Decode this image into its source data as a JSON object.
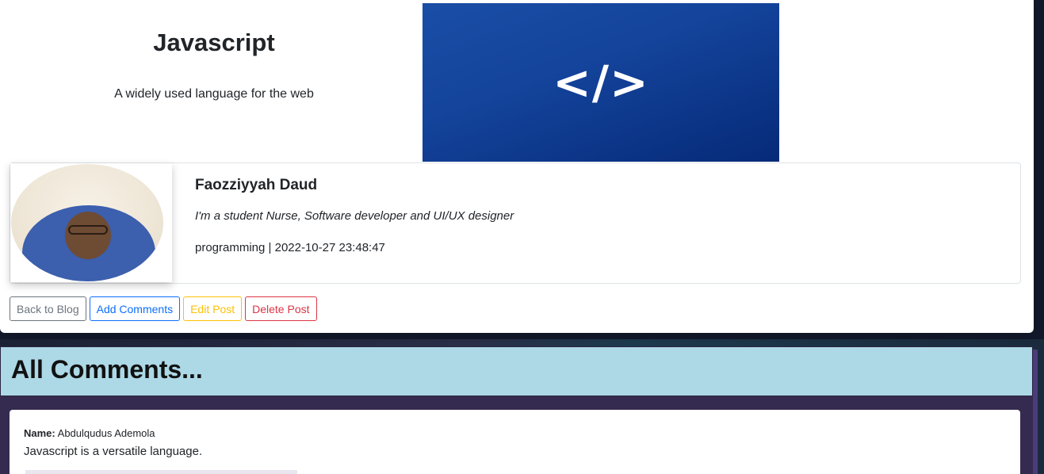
{
  "post": {
    "title": "Javascript",
    "subtitle": "A widely used language for the web",
    "image_symbol": "</>"
  },
  "author": {
    "name": "Faozziyyah Daud",
    "bio": "I'm a student Nurse, Software developer and UI/UX designer",
    "meta": "programming | 2022-10-27 23:48:47"
  },
  "actions": {
    "back": "Back to Blog",
    "add_comments": "Add Comments",
    "edit": "Edit Post",
    "delete": "Delete Post"
  },
  "comments": {
    "heading": "All Comments...",
    "items": [
      {
        "name_label": "Name:",
        "name": "Abdulqudus Ademola",
        "text": "Javascript is a versatile language."
      }
    ]
  },
  "colors": {
    "primary": "#0d6efd",
    "secondary": "#6c757d",
    "warning": "#ffc107",
    "danger": "#dc3545",
    "comments_header_bg": "#add8e6",
    "comments_bg": "#352b50",
    "post_image_bg": "#14449c"
  }
}
